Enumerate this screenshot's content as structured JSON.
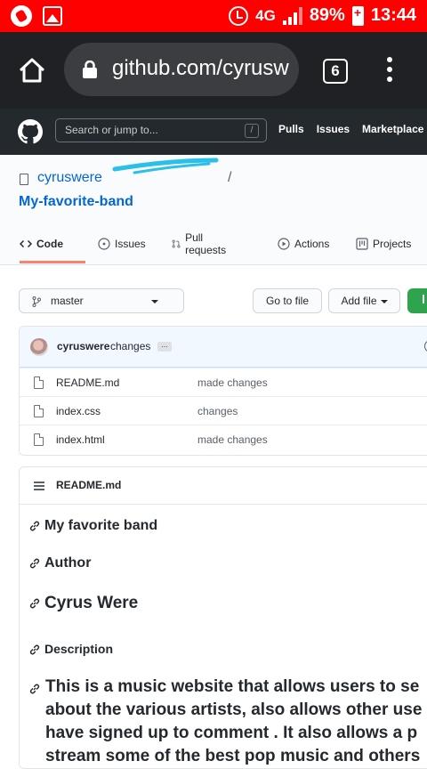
{
  "statusbar": {
    "network": "4G",
    "battery": "89%",
    "time": "13:44"
  },
  "browser": {
    "url_visible": "github.com/cyrusw",
    "tab_count": "6"
  },
  "github_header": {
    "search_placeholder": "Search or jump to...",
    "slash_key": "/",
    "nav": [
      "Pulls",
      "Issues",
      "Marketplace"
    ]
  },
  "repo": {
    "owner": "cyruswere",
    "separator": "/",
    "name": "My-favorite-band",
    "tabs": [
      {
        "label": "Code",
        "icon": "code-icon",
        "active": true
      },
      {
        "label": "Issues",
        "icon": "issue-icon"
      },
      {
        "label": "Pull requests",
        "icon": "pull-request-icon"
      },
      {
        "label": "Actions",
        "icon": "play-icon"
      },
      {
        "label": "Projects",
        "icon": "project-icon"
      }
    ]
  },
  "toolbar": {
    "branch": "master",
    "go_to_file": "Go to file",
    "add_file": "Add file"
  },
  "commit": {
    "user": "cyruswere",
    "message": "changes",
    "ellipsis": "..."
  },
  "files": [
    {
      "name": "README.md",
      "message": "made changes"
    },
    {
      "name": "index.css",
      "message": "changes"
    },
    {
      "name": "index.html",
      "message": "made changes"
    }
  ],
  "readme": {
    "title": "README.md",
    "heading1": "My favorite band",
    "heading2": "Author",
    "heading3": "Cyrus Were",
    "heading4": "Description",
    "description_lines": [
      "This is a music website that allows users to se",
      "about the various artists, also allows other use",
      "have signed up to comment . It also allows a p",
      "stream some of the best pop music and others"
    ]
  },
  "colors": {
    "statusbar": "#ff0000",
    "browser_bar": "#202124",
    "github_header": "#24292e",
    "link_blue": "#0366d6",
    "tab_underline": "#f9826c",
    "code_button_green": "#2ea44f",
    "scribble": "#2bc0ea"
  }
}
